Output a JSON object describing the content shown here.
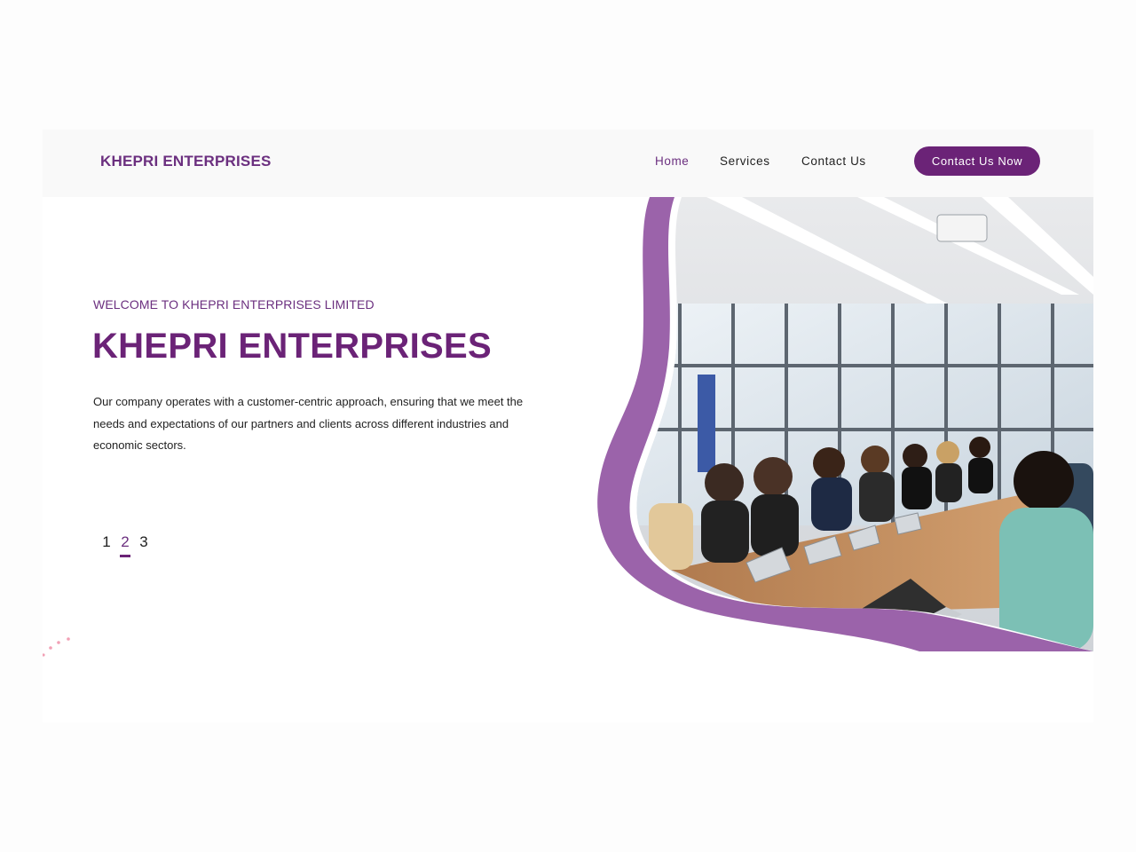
{
  "header": {
    "brand": "KHEPRI ENTERPRISES",
    "nav": [
      {
        "label": "Home",
        "active": true
      },
      {
        "label": "Services",
        "active": false
      },
      {
        "label": "Contact Us",
        "active": false
      }
    ],
    "cta_label": "Contact Us Now"
  },
  "hero": {
    "eyebrow": "WELCOME TO KHEPRI ENTERPRISES LIMITED",
    "title": "KHEPRI ENTERPRISES",
    "description": "Our company operates with a customer-centric approach, ensuring that we meet the needs and expectations of our partners and clients across different industries and economic sectors.",
    "pager": [
      "1",
      "2",
      "3"
    ],
    "active_page": "2"
  },
  "colors": {
    "brand": "#6b2377",
    "accent_blob": "#9b63aa",
    "header_bg": "#f9f9f9"
  },
  "image": {
    "subject": "meeting-room-photo-icon"
  }
}
